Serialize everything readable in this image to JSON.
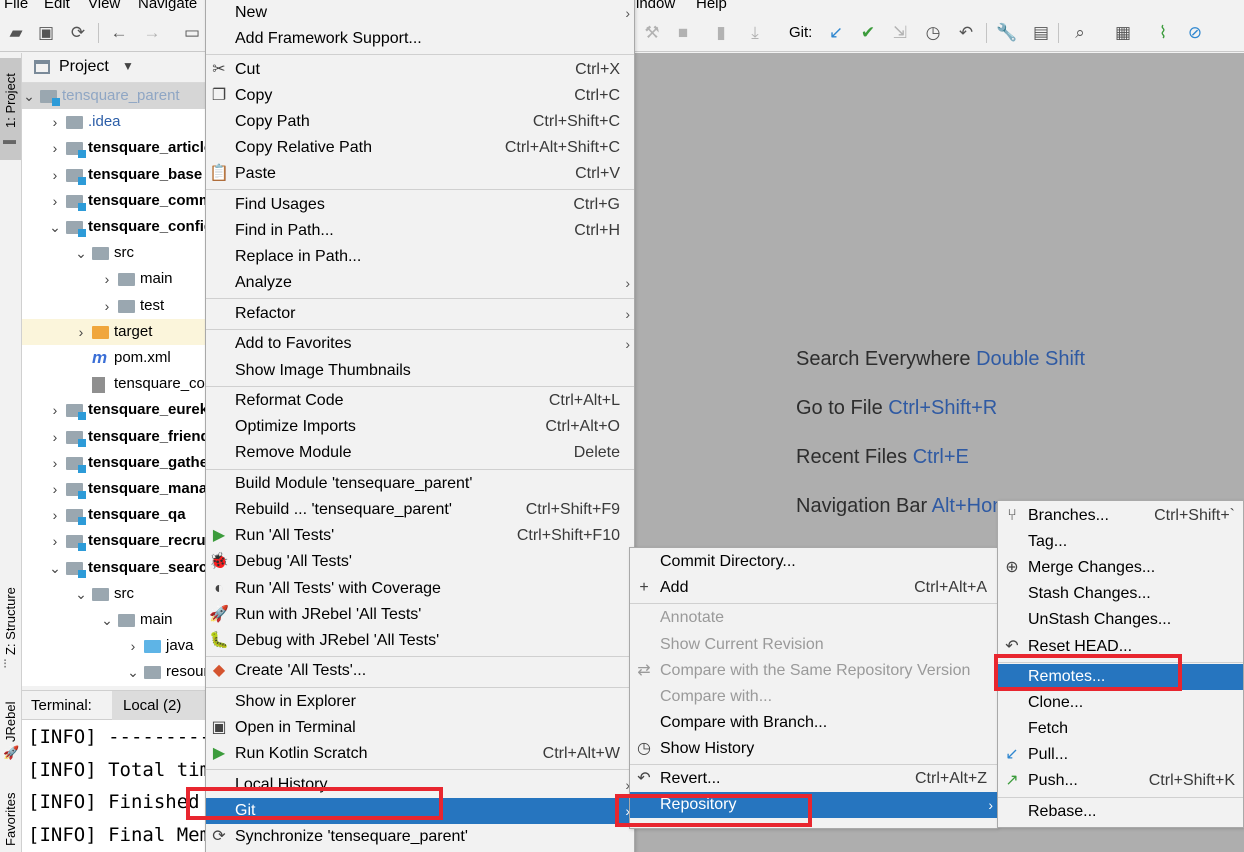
{
  "menubar": {
    "file": "File",
    "edit": "Edit",
    "view": "View",
    "navigate": "Navigate",
    "window": "indow",
    "help": "Help"
  },
  "toolbar": {
    "git_label": "Git:"
  },
  "stripe": {
    "project": "1: Project",
    "structure": "Z: Structure",
    "jrebel": "JRebel",
    "favorites": "Favorites"
  },
  "project_panel": {
    "title": "Project",
    "tree": [
      {
        "label": "tensquare_parent",
        "indent": 0,
        "arrow": "▾",
        "icon": "module",
        "style": "g",
        "state": "sel"
      },
      {
        "label": ".idea",
        "indent": 1,
        "arrow": "›",
        "icon": "folder",
        "style": "bl"
      },
      {
        "label": "tensquare_article",
        "indent": 1,
        "arrow": "›",
        "icon": "module",
        "style": "b"
      },
      {
        "label": "tensquare_base",
        "indent": 1,
        "arrow": "›",
        "icon": "module",
        "style": "b"
      },
      {
        "label": "tensquare_common",
        "indent": 1,
        "arrow": "›",
        "icon": "module",
        "style": "b"
      },
      {
        "label": "tensquare_config",
        "indent": 1,
        "arrow": "▾",
        "icon": "module",
        "style": "b"
      },
      {
        "label": "src",
        "indent": 2,
        "arrow": "▾",
        "icon": "folder"
      },
      {
        "label": "main",
        "indent": 3,
        "arrow": "›",
        "icon": "folder"
      },
      {
        "label": "test",
        "indent": 3,
        "arrow": "›",
        "icon": "folder"
      },
      {
        "label": "target",
        "indent": 2,
        "arrow": "›",
        "icon": "orange",
        "state": "hl"
      },
      {
        "label": "pom.xml",
        "indent": 2,
        "arrow": "",
        "icon": "maven"
      },
      {
        "label": "tensquare_config.iml",
        "indent": 2,
        "arrow": "",
        "icon": "file"
      },
      {
        "label": "tensquare_eureka",
        "indent": 1,
        "arrow": "›",
        "icon": "module",
        "style": "b"
      },
      {
        "label": "tensquare_friend",
        "indent": 1,
        "arrow": "›",
        "icon": "module",
        "style": "b"
      },
      {
        "label": "tensquare_gathering",
        "indent": 1,
        "arrow": "›",
        "icon": "module",
        "style": "b"
      },
      {
        "label": "tensquare_manager",
        "indent": 1,
        "arrow": "›",
        "icon": "module",
        "style": "b"
      },
      {
        "label": "tensquare_qa",
        "indent": 1,
        "arrow": "›",
        "icon": "module",
        "style": "b"
      },
      {
        "label": "tensquare_recruit",
        "indent": 1,
        "arrow": "›",
        "icon": "module",
        "style": "b"
      },
      {
        "label": "tensquare_search",
        "indent": 1,
        "arrow": "▾",
        "icon": "module",
        "style": "b"
      },
      {
        "label": "src",
        "indent": 2,
        "arrow": "▾",
        "icon": "folder"
      },
      {
        "label": "main",
        "indent": 3,
        "arrow": "▾",
        "icon": "folder"
      },
      {
        "label": "java",
        "indent": 4,
        "arrow": "›",
        "icon": "blue"
      },
      {
        "label": "resources",
        "indent": 4,
        "arrow": "▾",
        "icon": "folder"
      }
    ]
  },
  "terminal": {
    "label": "Terminal:",
    "tab": "Local (2)",
    "lines": [
      "[INFO] ------------------------",
      "[INFO] Total time",
      "[INFO] Finished at",
      "[INFO] Final Memory"
    ]
  },
  "editor_hints": [
    {
      "text": "Search Everywhere",
      "key": "Double Shift"
    },
    {
      "text": "Go to File",
      "key": "Ctrl+Shift+R"
    },
    {
      "text": "Recent Files",
      "key": "Ctrl+E"
    },
    {
      "text": "Navigation Bar",
      "key": "Alt+Home"
    }
  ],
  "context_menu": {
    "items": [
      {
        "label": "New",
        "shortcut": "",
        "sub": true,
        "icon": ""
      },
      {
        "label": "Add Framework Support...",
        "shortcut": "",
        "sub": false,
        "icon": ""
      },
      {
        "sep": true
      },
      {
        "label": "Cut",
        "shortcut": "Ctrl+X",
        "icon": "✂"
      },
      {
        "label": "Copy",
        "shortcut": "Ctrl+C",
        "icon": "❐"
      },
      {
        "label": "Copy Path",
        "shortcut": "Ctrl+Shift+C",
        "icon": ""
      },
      {
        "label": "Copy Relative Path",
        "shortcut": "Ctrl+Alt+Shift+C",
        "icon": ""
      },
      {
        "label": "Paste",
        "shortcut": "Ctrl+V",
        "icon": "📋"
      },
      {
        "sep": true
      },
      {
        "label": "Find Usages",
        "shortcut": "Ctrl+G",
        "icon": ""
      },
      {
        "label": "Find in Path...",
        "shortcut": "Ctrl+H",
        "icon": ""
      },
      {
        "label": "Replace in Path...",
        "shortcut": "",
        "icon": ""
      },
      {
        "label": "Analyze",
        "shortcut": "",
        "sub": true,
        "icon": ""
      },
      {
        "sep": true
      },
      {
        "label": "Refactor",
        "shortcut": "",
        "sub": true,
        "icon": ""
      },
      {
        "sep": true
      },
      {
        "label": "Add to Favorites",
        "shortcut": "",
        "sub": true,
        "icon": ""
      },
      {
        "label": "Show Image Thumbnails",
        "shortcut": "",
        "icon": ""
      },
      {
        "sep": true
      },
      {
        "label": "Reformat Code",
        "shortcut": "Ctrl+Alt+L",
        "icon": ""
      },
      {
        "label": "Optimize Imports",
        "shortcut": "Ctrl+Alt+O",
        "icon": ""
      },
      {
        "label": "Remove Module",
        "shortcut": "Delete",
        "icon": ""
      },
      {
        "sep": true
      },
      {
        "label": "Build Module 'tensequare_parent'",
        "shortcut": "",
        "icon": ""
      },
      {
        "label": "Rebuild ... 'tensequare_parent'",
        "shortcut": "Ctrl+Shift+F9",
        "icon": ""
      },
      {
        "label": "Run 'All Tests'",
        "shortcut": "Ctrl+Shift+F10",
        "icon": "▶",
        "iconColor": "#3c9c3c"
      },
      {
        "label": "Debug 'All Tests'",
        "shortcut": "",
        "icon": "🐞",
        "iconColor": "#3c9c3c"
      },
      {
        "label": "Run 'All Tests' with Coverage",
        "shortcut": "",
        "icon": "◐"
      },
      {
        "label": "Run with JRebel 'All Tests'",
        "shortcut": "",
        "icon": "🚀",
        "iconColor": "#5a9c3c"
      },
      {
        "label": "Debug with JRebel 'All Tests'",
        "shortcut": "",
        "icon": "🐛",
        "iconColor": "#5a9c3c"
      },
      {
        "sep": true
      },
      {
        "label": "Create 'All Tests'...",
        "shortcut": "",
        "icon": "◆",
        "iconColor": "#d4542f"
      },
      {
        "sep": true
      },
      {
        "label": "Show in Explorer",
        "shortcut": "",
        "icon": ""
      },
      {
        "label": "Open in Terminal",
        "shortcut": "",
        "icon": "▣"
      },
      {
        "label": "Run Kotlin Scratch",
        "shortcut": "Ctrl+Alt+W",
        "icon": "▶",
        "iconColor": "#3c9c3c"
      },
      {
        "sep": true
      },
      {
        "label": "Local History",
        "shortcut": "",
        "sub": true,
        "icon": ""
      },
      {
        "label": "Git",
        "shortcut": "",
        "sub": true,
        "icon": "",
        "active": true
      },
      {
        "label": "Synchronize 'tensequare_parent'",
        "shortcut": "",
        "icon": "⟳"
      }
    ]
  },
  "git_menu": {
    "items": [
      {
        "label": "Commit Directory...",
        "shortcut": "",
        "icon": ""
      },
      {
        "label": "Add",
        "shortcut": "Ctrl+Alt+A",
        "icon": "+"
      },
      {
        "sep": true
      },
      {
        "label": "Annotate",
        "shortcut": "",
        "icon": "",
        "disabled": true
      },
      {
        "label": "Show Current Revision",
        "shortcut": "",
        "icon": "",
        "disabled": true
      },
      {
        "label": "Compare with the Same Repository Version",
        "shortcut": "",
        "icon": "⇄",
        "disabled": true
      },
      {
        "label": "Compare with...",
        "shortcut": "",
        "icon": "",
        "disabled": true
      },
      {
        "label": "Compare with Branch...",
        "shortcut": "",
        "icon": ""
      },
      {
        "label": "Show History",
        "shortcut": "",
        "icon": "◷"
      },
      {
        "sep": true
      },
      {
        "label": "Revert...",
        "shortcut": "Ctrl+Alt+Z",
        "icon": "↶"
      },
      {
        "label": "Repository",
        "shortcut": "",
        "sub": true,
        "icon": "",
        "active": true
      }
    ]
  },
  "repo_menu": {
    "items": [
      {
        "label": "Branches...",
        "shortcut": "Ctrl+Shift+`",
        "icon": "⑂"
      },
      {
        "label": "Tag...",
        "shortcut": "",
        "icon": ""
      },
      {
        "label": "Merge Changes...",
        "shortcut": "",
        "icon": "⊕"
      },
      {
        "label": "Stash Changes...",
        "shortcut": "",
        "icon": ""
      },
      {
        "label": "UnStash Changes...",
        "shortcut": "",
        "icon": ""
      },
      {
        "label": "Reset HEAD...",
        "shortcut": "",
        "icon": "↶"
      },
      {
        "sep": true
      },
      {
        "label": "Remotes...",
        "shortcut": "",
        "icon": "",
        "active": true
      },
      {
        "label": "Clone...",
        "shortcut": "",
        "icon": ""
      },
      {
        "label": "Fetch",
        "shortcut": "",
        "icon": ""
      },
      {
        "label": "Pull...",
        "shortcut": "",
        "icon": "↙",
        "iconColor": "#2f87d0"
      },
      {
        "label": "Push...",
        "shortcut": "Ctrl+Shift+K",
        "icon": "↗",
        "iconColor": "#3c9c3c"
      },
      {
        "sep": true
      },
      {
        "label": "Rebase...",
        "shortcut": "",
        "icon": ""
      }
    ]
  }
}
